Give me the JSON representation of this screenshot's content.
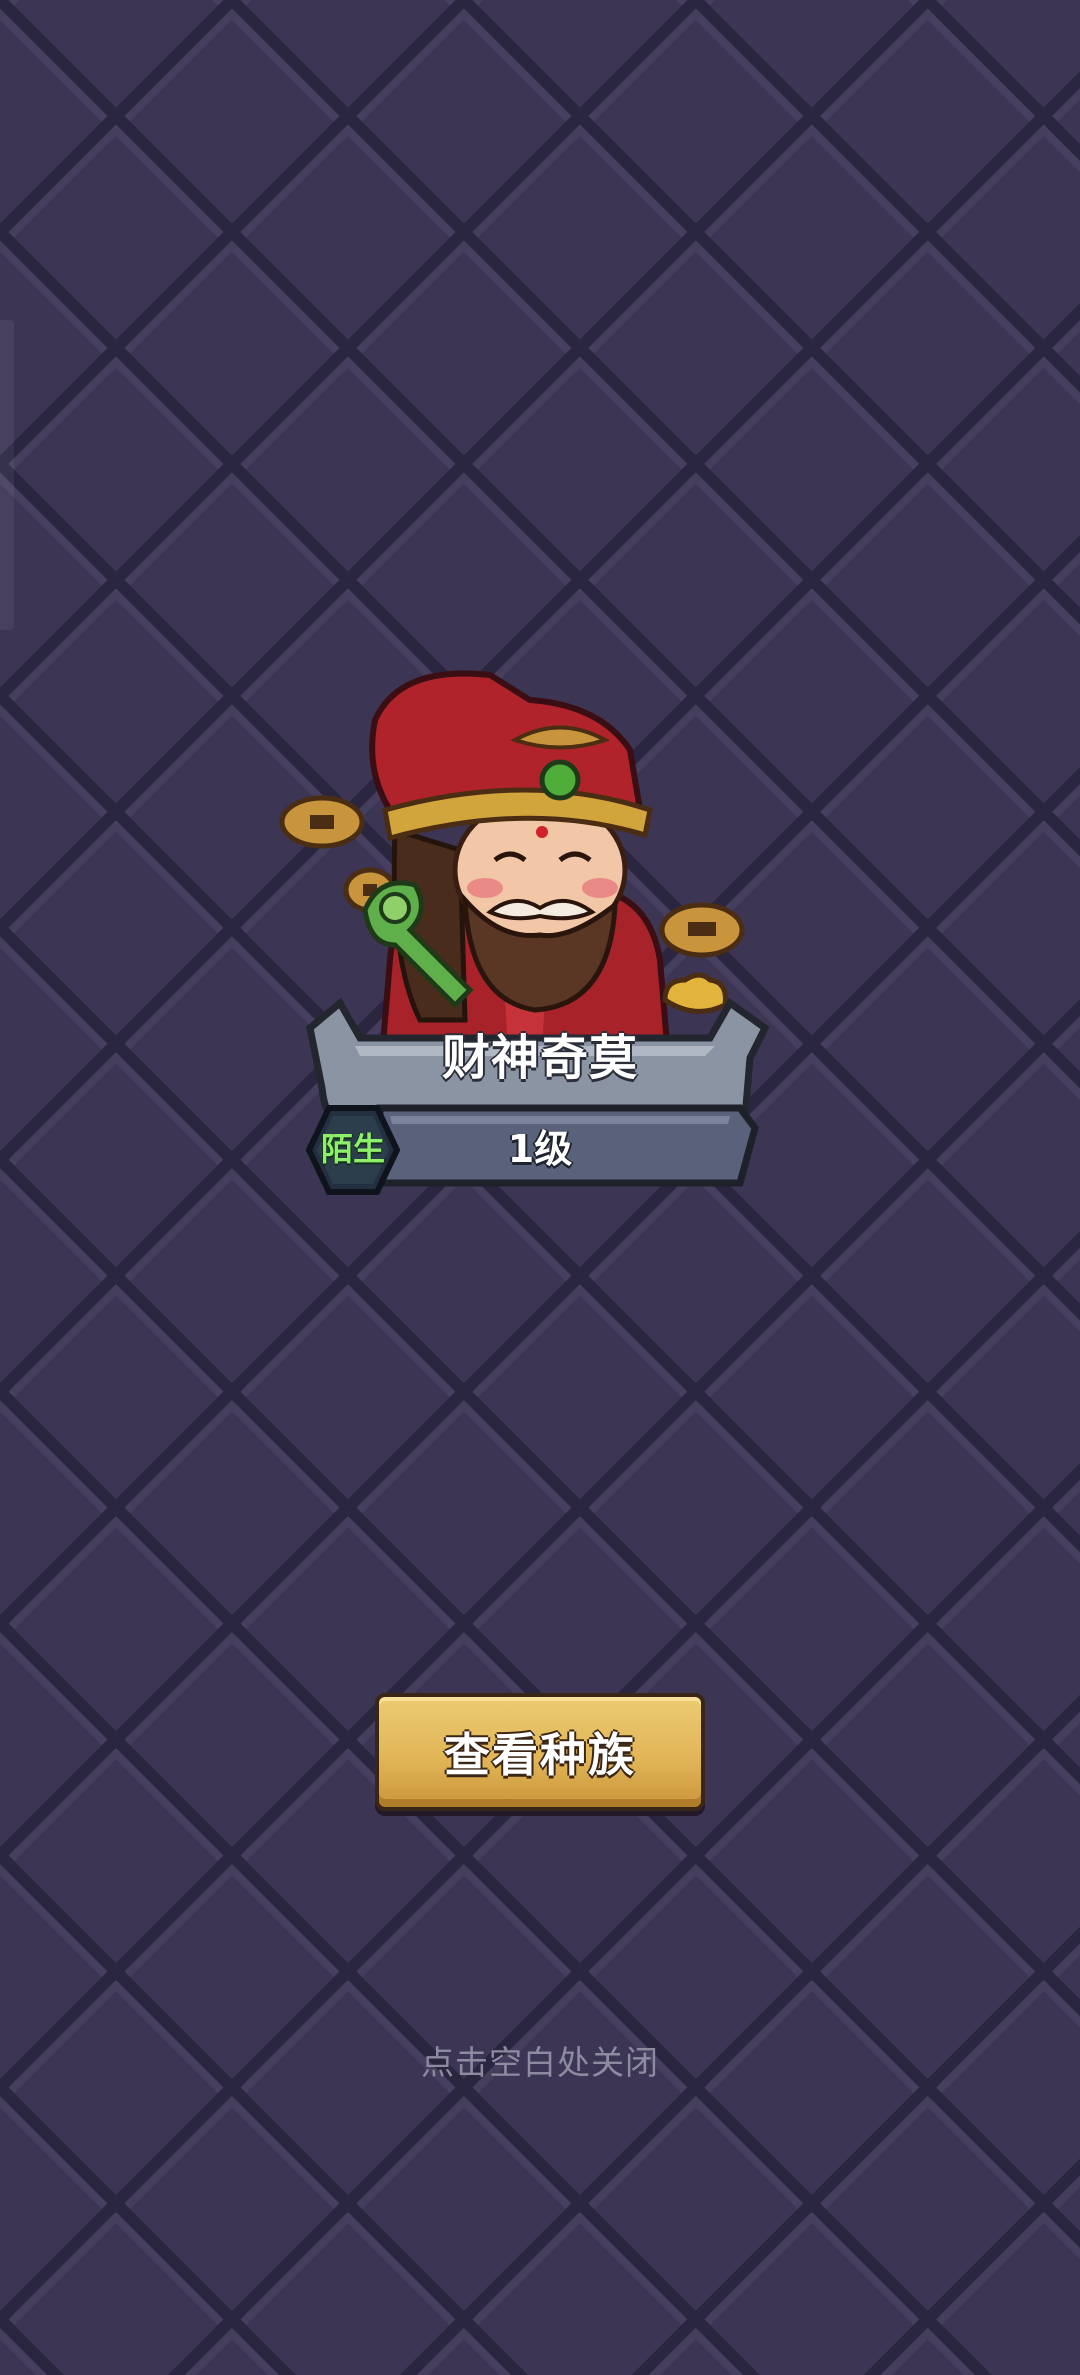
{
  "character": {
    "name": "财神奇莫",
    "level": "1级",
    "relation_badge": "陌生"
  },
  "actions": {
    "view_race_label": "查看种族"
  },
  "hint": {
    "close_text": "点击空白处关闭"
  },
  "colors": {
    "background": "#3b3452",
    "tile_dark": "#2d2840",
    "button_gold": "#e2b658",
    "badge_green": "#8ef06a",
    "plate_steel": "#5b6478"
  },
  "icons": {
    "character_portrait": "god-of-wealth-portrait",
    "relation_badge_shape": "hexagon-badge"
  }
}
